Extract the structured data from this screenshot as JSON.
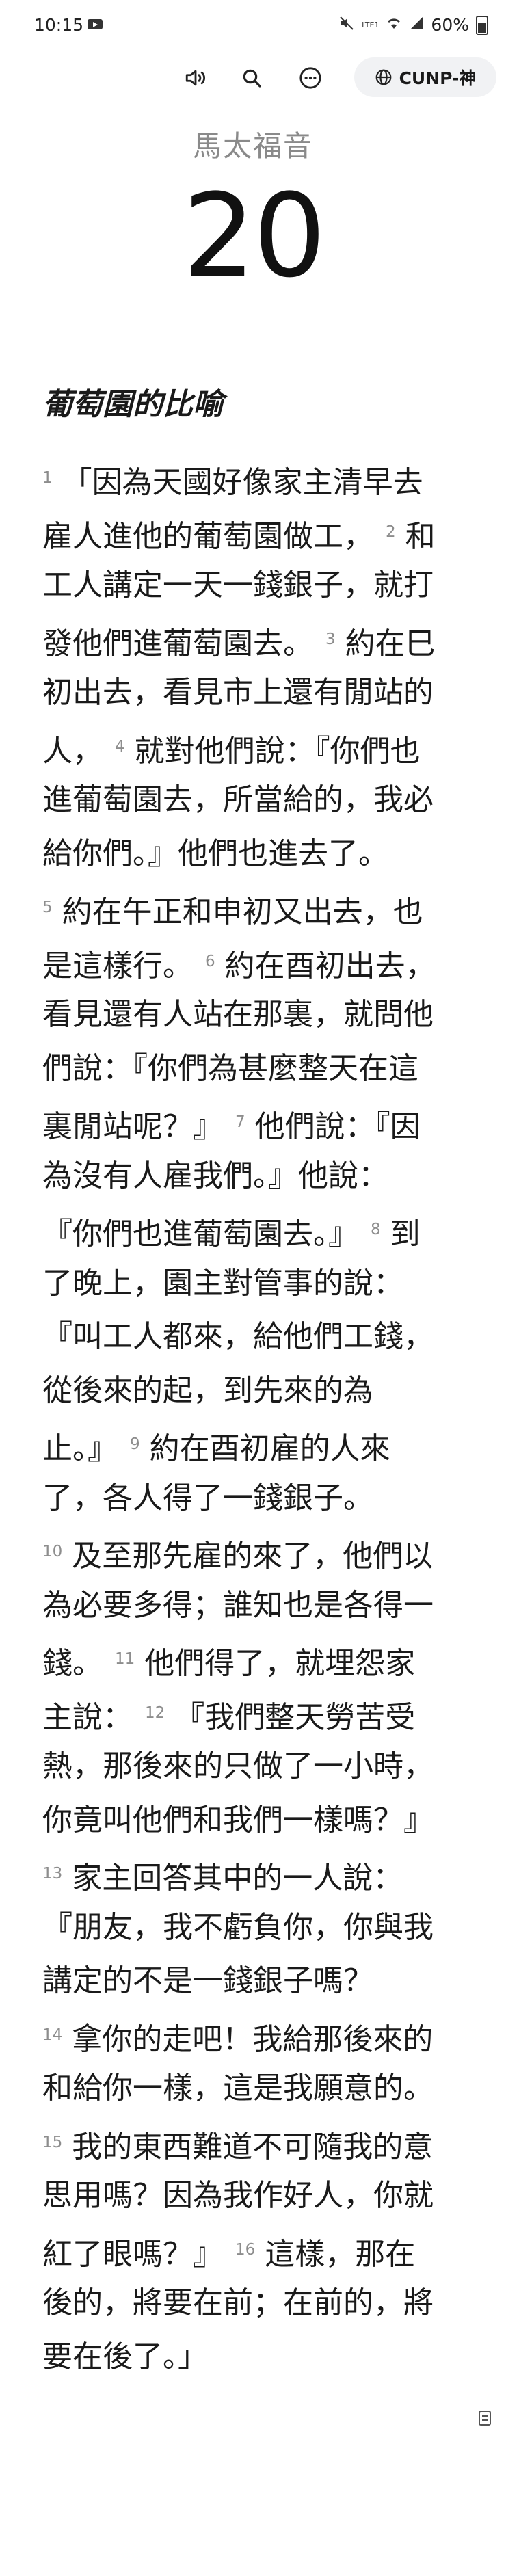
{
  "status_bar": {
    "time": "10:15",
    "lte": "LTE1",
    "battery": "60%",
    "icons": [
      "mute-icon",
      "wifi-icon",
      "signal-icon",
      "battery-icon"
    ]
  },
  "toolbar": {
    "version_label": "CUNP-神",
    "icons": [
      "audio-icon",
      "search-icon",
      "more-icon",
      "globe-icon"
    ]
  },
  "book": {
    "title": "馬太福音",
    "chapter": "20"
  },
  "section": {
    "heading": "葡萄園的比喻"
  },
  "lines": [
    [
      {
        "v": "1"
      },
      {
        "t": "「因為天國好像家主清早去"
      }
    ],
    [
      {
        "t": "雇人進他的葡萄園做工，"
      },
      {
        "g": 1
      },
      {
        "v": "2"
      },
      {
        "t": "和"
      }
    ],
    [
      {
        "t": "工人講定一天一錢銀子，就打"
      }
    ],
    [
      {
        "t": "發他們進葡萄園去。"
      },
      {
        "g": 1
      },
      {
        "v": "3"
      },
      {
        "t": "約在巳"
      }
    ],
    [
      {
        "t": "初出去，看見市上還有閒站的"
      }
    ],
    [
      {
        "t": "人，"
      },
      {
        "g": 1
      },
      {
        "v": "4"
      },
      {
        "t": "就對他們說：『你們也"
      }
    ],
    [
      {
        "t": "進葡萄園去，所當給的，我必"
      }
    ],
    [
      {
        "t": "給你們。』他們也進去了。"
      }
    ],
    [
      {
        "v": "5"
      },
      {
        "t": "約在午正和申初又出去，也"
      }
    ],
    [
      {
        "t": "是這樣行。"
      },
      {
        "g": 1
      },
      {
        "v": "6"
      },
      {
        "t": "約在酉初出去，"
      }
    ],
    [
      {
        "t": "看見還有人站在那裏，就問他"
      }
    ],
    [
      {
        "t": "們說：『你們為甚麼整天在這"
      }
    ],
    [
      {
        "t": "裏閒站呢？』"
      },
      {
        "g": 1
      },
      {
        "v": "7"
      },
      {
        "t": "他們說：『因"
      }
    ],
    [
      {
        "t": "為沒有人雇我們。』他說："
      }
    ],
    [
      {
        "t": "『你們也進葡萄園去。』"
      },
      {
        "g": 1
      },
      {
        "v": "8"
      },
      {
        "t": "到"
      }
    ],
    [
      {
        "t": "了晚上，園主對管事的說："
      }
    ],
    [
      {
        "t": "『叫工人都來，給他們工錢，"
      }
    ],
    [
      {
        "t": "從後來的起，到先來的為"
      }
    ],
    [
      {
        "t": "止。』"
      },
      {
        "g": 1
      },
      {
        "v": "9"
      },
      {
        "t": "約在酉初雇的人來"
      }
    ],
    [
      {
        "t": "了，各人得了一錢銀子。"
      }
    ],
    [
      {
        "v": "10"
      },
      {
        "t": "及至那先雇的來了，他們以"
      }
    ],
    [
      {
        "t": "為必要多得；誰知也是各得一"
      }
    ],
    [
      {
        "t": "錢。"
      },
      {
        "g": 1
      },
      {
        "v": "11"
      },
      {
        "t": "他們得了，就埋怨家"
      }
    ],
    [
      {
        "t": "主說："
      },
      {
        "g": 1
      },
      {
        "v": "12"
      },
      {
        "t": "『我們整天勞苦受"
      }
    ],
    [
      {
        "t": "熱，那後來的只做了一小時，"
      }
    ],
    [
      {
        "t": "你竟叫他們和我們一樣嗎？』"
      }
    ],
    [
      {
        "v": "13"
      },
      {
        "t": "家主回答其中的一人說："
      }
    ],
    [
      {
        "t": "『朋友，我不虧負你，你與我"
      }
    ],
    [
      {
        "t": "講定的不是一錢銀子嗎？"
      }
    ],
    [
      {
        "v": "14"
      },
      {
        "t": "拿你的走吧！我給那後來的"
      }
    ],
    [
      {
        "t": "和給你一樣，這是我願意的。"
      }
    ],
    [
      {
        "v": "15"
      },
      {
        "t": "我的東西難道不可隨我的意"
      }
    ],
    [
      {
        "t": "思用嗎？因為我作好人，你就"
      }
    ],
    [
      {
        "t": "紅了眼嗎？』"
      },
      {
        "g": 1
      },
      {
        "v": "16"
      },
      {
        "t": "這樣，那在"
      }
    ],
    [
      {
        "t": "後的，將要在前；在前的，將"
      }
    ],
    [
      {
        "t": "要在後了。」"
      }
    ]
  ]
}
